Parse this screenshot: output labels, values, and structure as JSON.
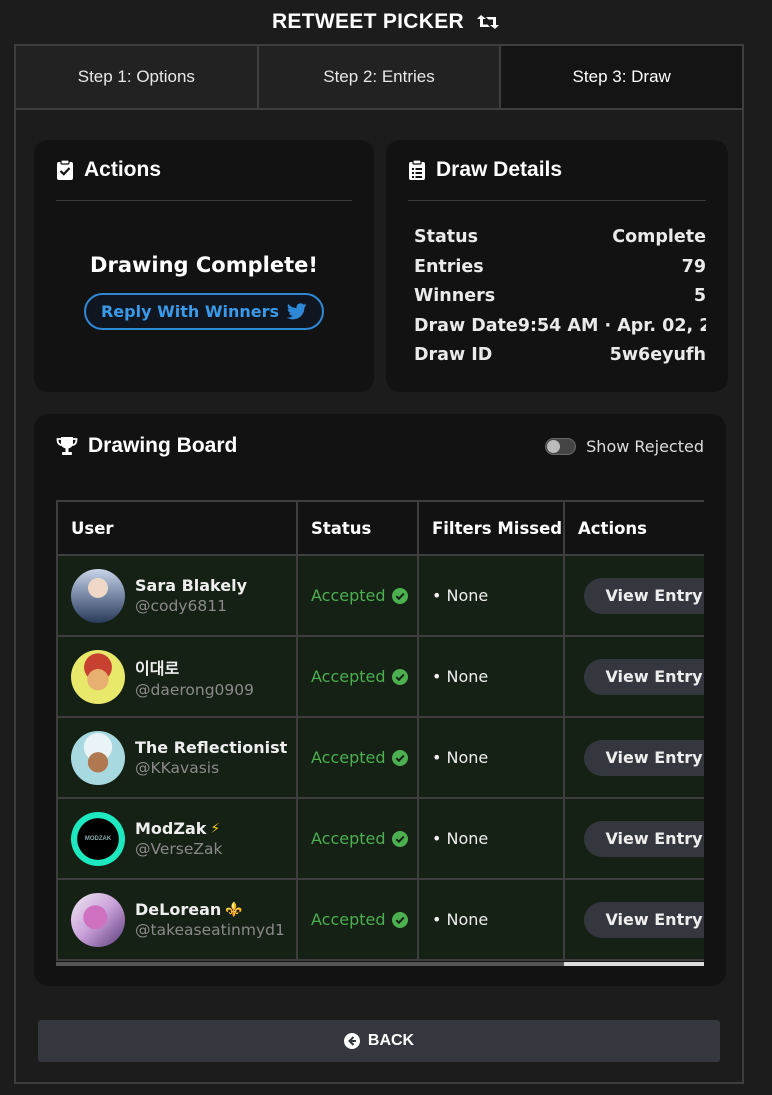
{
  "app": {
    "title": "RETWEET PICKER"
  },
  "tabs": [
    {
      "label": "Step 1: Options"
    },
    {
      "label": "Step 2: Entries"
    },
    {
      "label": "Step 3: Draw"
    }
  ],
  "actions": {
    "title": "Actions",
    "message": "Drawing Complete!",
    "reply_label": "Reply With Winners"
  },
  "details": {
    "title": "Draw Details",
    "rows": [
      {
        "label": "Status",
        "value": "Complete"
      },
      {
        "label": "Entries",
        "value": "79"
      },
      {
        "label": "Winners",
        "value": "5"
      },
      {
        "label": "Draw Date",
        "value": "9:54 AM · Apr. 02, 2"
      },
      {
        "label": "Draw ID",
        "value": "5w6eyufh"
      }
    ]
  },
  "board": {
    "title": "Drawing Board",
    "toggle_label": "Show Rejected",
    "columns": [
      "User",
      "Status",
      "Filters Missed",
      "Actions"
    ],
    "rows": [
      {
        "name": "Sara Blakely",
        "handle": "@cody6811",
        "status": "Accepted",
        "filters": "• None",
        "action": "View Entry",
        "badge": ""
      },
      {
        "name": "이대로",
        "handle": "@daerong0909",
        "status": "Accepted",
        "filters": "• None",
        "action": "View Entry",
        "badge": ""
      },
      {
        "name": "The Reflectionist",
        "handle": "@KKavasis",
        "status": "Accepted",
        "filters": "• None",
        "action": "View Entry",
        "badge": ""
      },
      {
        "name": "ModZak",
        "handle": "@VerseZak",
        "status": "Accepted",
        "filters": "• None",
        "action": "View Entry",
        "badge": "⚡"
      },
      {
        "name": "DeLorean",
        "handle": "@takeaseatinmyd1",
        "status": "Accepted",
        "filters": "• None",
        "action": "View Entry",
        "badge": "⚜️"
      }
    ]
  },
  "footer": {
    "back_label": "BACK"
  },
  "colors": {
    "accepted": "#4caf50",
    "twitter": "#2f88d6",
    "row_bg": "#142114"
  },
  "avatar_text": {
    "modzak": "MODZAK"
  }
}
